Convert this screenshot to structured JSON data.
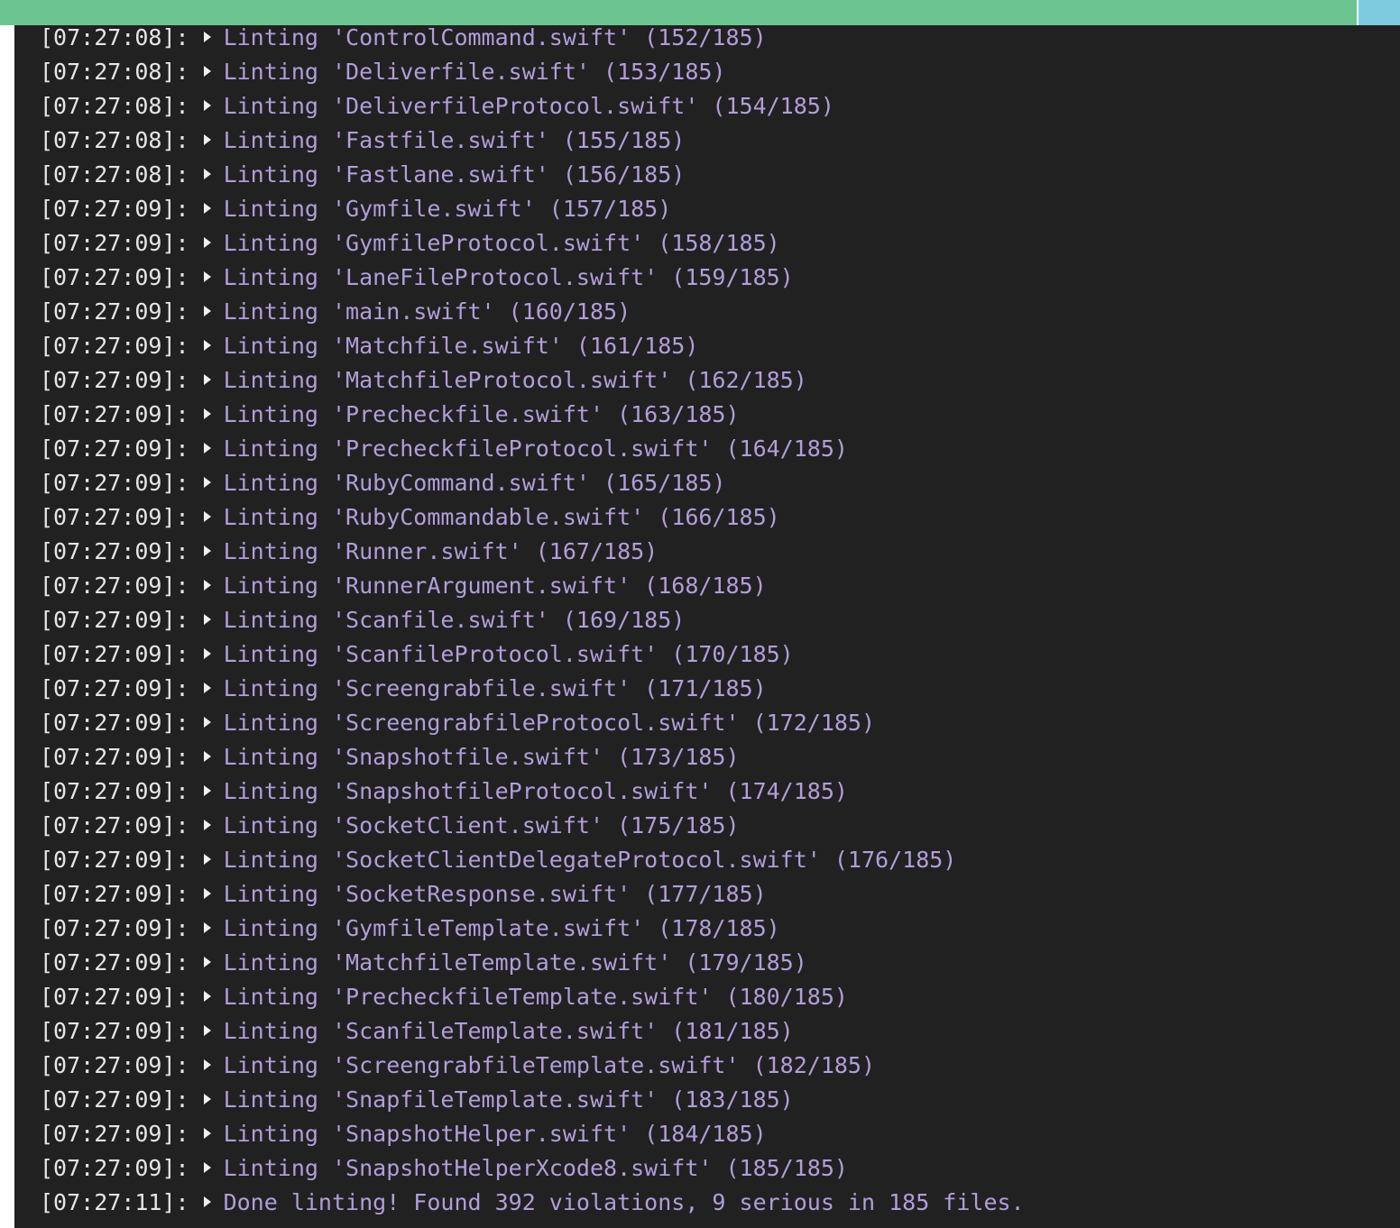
{
  "log": {
    "lines": [
      {
        "time": "[07:27:08]",
        "message": "Linting 'ControlCommand.swift' (152/185)"
      },
      {
        "time": "[07:27:08]",
        "message": "Linting 'Deliverfile.swift' (153/185)"
      },
      {
        "time": "[07:27:08]",
        "message": "Linting 'DeliverfileProtocol.swift' (154/185)"
      },
      {
        "time": "[07:27:08]",
        "message": "Linting 'Fastfile.swift' (155/185)"
      },
      {
        "time": "[07:27:08]",
        "message": "Linting 'Fastlane.swift' (156/185)"
      },
      {
        "time": "[07:27:09]",
        "message": "Linting 'Gymfile.swift' (157/185)"
      },
      {
        "time": "[07:27:09]",
        "message": "Linting 'GymfileProtocol.swift' (158/185)"
      },
      {
        "time": "[07:27:09]",
        "message": "Linting 'LaneFileProtocol.swift' (159/185)"
      },
      {
        "time": "[07:27:09]",
        "message": "Linting 'main.swift' (160/185)"
      },
      {
        "time": "[07:27:09]",
        "message": "Linting 'Matchfile.swift' (161/185)"
      },
      {
        "time": "[07:27:09]",
        "message": "Linting 'MatchfileProtocol.swift' (162/185)"
      },
      {
        "time": "[07:27:09]",
        "message": "Linting 'Precheckfile.swift' (163/185)"
      },
      {
        "time": "[07:27:09]",
        "message": "Linting 'PrecheckfileProtocol.swift' (164/185)"
      },
      {
        "time": "[07:27:09]",
        "message": "Linting 'RubyCommand.swift' (165/185)"
      },
      {
        "time": "[07:27:09]",
        "message": "Linting 'RubyCommandable.swift' (166/185)"
      },
      {
        "time": "[07:27:09]",
        "message": "Linting 'Runner.swift' (167/185)"
      },
      {
        "time": "[07:27:09]",
        "message": "Linting 'RunnerArgument.swift' (168/185)"
      },
      {
        "time": "[07:27:09]",
        "message": "Linting 'Scanfile.swift' (169/185)"
      },
      {
        "time": "[07:27:09]",
        "message": "Linting 'ScanfileProtocol.swift' (170/185)"
      },
      {
        "time": "[07:27:09]",
        "message": "Linting 'Screengrabfile.swift' (171/185)"
      },
      {
        "time": "[07:27:09]",
        "message": "Linting 'ScreengrabfileProtocol.swift' (172/185)"
      },
      {
        "time": "[07:27:09]",
        "message": "Linting 'Snapshotfile.swift' (173/185)"
      },
      {
        "time": "[07:27:09]",
        "message": "Linting 'SnapshotfileProtocol.swift' (174/185)"
      },
      {
        "time": "[07:27:09]",
        "message": "Linting 'SocketClient.swift' (175/185)"
      },
      {
        "time": "[07:27:09]",
        "message": "Linting 'SocketClientDelegateProtocol.swift' (176/185)"
      },
      {
        "time": "[07:27:09]",
        "message": "Linting 'SocketResponse.swift' (177/185)"
      },
      {
        "time": "[07:27:09]",
        "message": "Linting 'GymfileTemplate.swift' (178/185)"
      },
      {
        "time": "[07:27:09]",
        "message": "Linting 'MatchfileTemplate.swift' (179/185)"
      },
      {
        "time": "[07:27:09]",
        "message": "Linting 'PrecheckfileTemplate.swift' (180/185)"
      },
      {
        "time": "[07:27:09]",
        "message": "Linting 'ScanfileTemplate.swift' (181/185)"
      },
      {
        "time": "[07:27:09]",
        "message": "Linting 'ScreengrabfileTemplate.swift' (182/185)"
      },
      {
        "time": "[07:27:09]",
        "message": "Linting 'SnapfileTemplate.swift' (183/185)"
      },
      {
        "time": "[07:27:09]",
        "message": "Linting 'SnapshotHelper.swift' (184/185)"
      },
      {
        "time": "[07:27:09]",
        "message": "Linting 'SnapshotHelperXcode8.swift' (185/185)"
      },
      {
        "time": "[07:27:11]",
        "message": "Done linting! Found 392 violations, 9 serious in 185 files."
      }
    ]
  },
  "colors": {
    "header_bar": "#6cc591",
    "header_accent": "#7ecbe0",
    "terminal_bg": "#212121",
    "message_text": "#b39ddb"
  },
  "icons": {
    "line_marker": "play-triangle-icon"
  }
}
